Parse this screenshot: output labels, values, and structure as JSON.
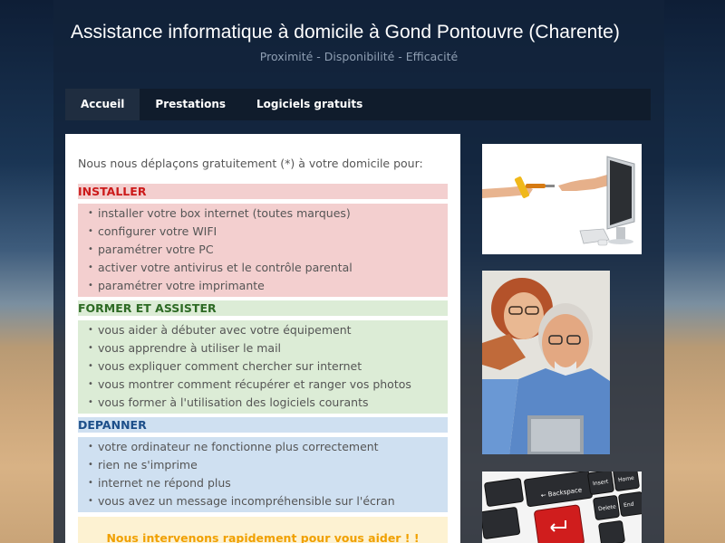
{
  "site": {
    "title": "Assistance informatique à domicile à Gond Pontouvre (Charente)",
    "tagline": "Proximité - Disponibilité - Efficacité"
  },
  "nav": {
    "items": [
      {
        "label": "Accueil",
        "active": true
      },
      {
        "label": "Prestations",
        "active": false
      },
      {
        "label": "Logiciels gratuits",
        "active": false
      }
    ]
  },
  "content": {
    "intro": "Nous nous déplaçons gratuitement (*) à votre domicile pour:",
    "sections": [
      {
        "heading": "INSTALLER",
        "color": "#cc1a1a",
        "items": [
          "installer votre box internet (toutes marques)",
          "configurer votre WIFI",
          "paramétrer votre PC",
          "activer votre antivirus et le contrôle parental",
          "paramétrer votre imprimante"
        ]
      },
      {
        "heading": "FORMER ET ASSISTER",
        "color": "#2d6a24",
        "items": [
          "vous aider à débuter avec  votre équipement",
          "vous apprendre à utiliser le mail",
          "vous expliquer comment chercher sur internet",
          "vous montrer comment récupérer et ranger vos photos",
          "vous former à l'utilisation des logiciels courants"
        ]
      },
      {
        "heading": "DEPANNER",
        "color": "#1d4f8a",
        "items": [
          "votre ordinateur ne fonctionne plus correctement",
          "rien ne s'imprime",
          "internet ne répond plus",
          "vous avez un message incompréhensible sur l'écran"
        ]
      }
    ],
    "cta": "Nous intervenons rapidement pour vous aider ! !"
  },
  "sidebar": {
    "keyboard_labels": {
      "backspace": "← Backspace",
      "insert": "Insert",
      "home": "Home",
      "delete": "Delete",
      "end": "End"
    }
  }
}
